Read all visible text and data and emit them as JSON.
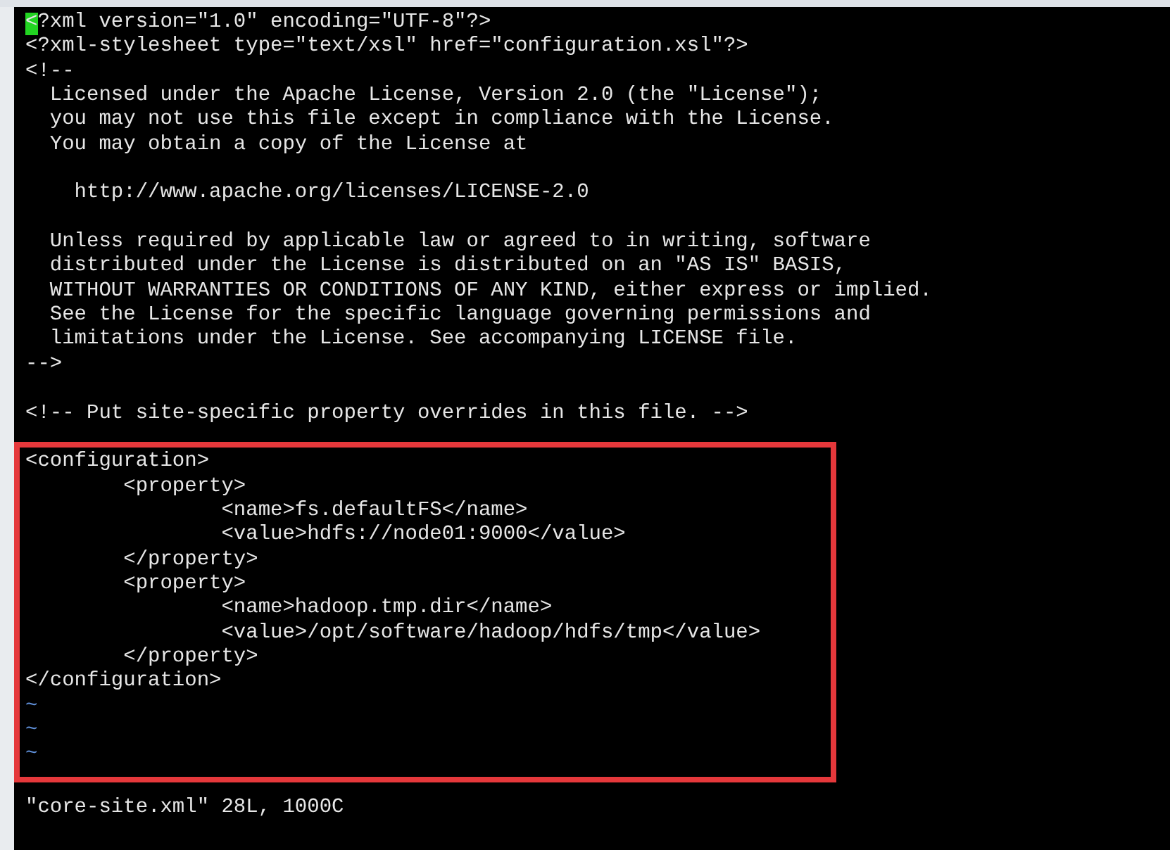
{
  "editor": {
    "lines": [
      {
        "kind": "text",
        "text": "<?xml version=\"1.0\" encoding=\"UTF-8\"?>",
        "cursor": true
      },
      {
        "kind": "text",
        "text": "<?xml-stylesheet type=\"text/xsl\" href=\"configuration.xsl\"?>"
      },
      {
        "kind": "text",
        "text": "<!--"
      },
      {
        "kind": "text",
        "text": "  Licensed under the Apache License, Version 2.0 (the \"License\");"
      },
      {
        "kind": "text",
        "text": "  you may not use this file except in compliance with the License."
      },
      {
        "kind": "text",
        "text": "  You may obtain a copy of the License at"
      },
      {
        "kind": "blank"
      },
      {
        "kind": "text",
        "text": "    http://www.apache.org/licenses/LICENSE-2.0"
      },
      {
        "kind": "blank"
      },
      {
        "kind": "text",
        "text": "  Unless required by applicable law or agreed to in writing, software"
      },
      {
        "kind": "text",
        "text": "  distributed under the License is distributed on an \"AS IS\" BASIS,"
      },
      {
        "kind": "text",
        "text": "  WITHOUT WARRANTIES OR CONDITIONS OF ANY KIND, either express or implied."
      },
      {
        "kind": "text",
        "text": "  See the License for the specific language governing permissions and"
      },
      {
        "kind": "text",
        "text": "  limitations under the License. See accompanying LICENSE file."
      },
      {
        "kind": "text",
        "text": "-->"
      },
      {
        "kind": "blank"
      },
      {
        "kind": "text",
        "text": "<!-- Put site-specific property overrides in this file. -->"
      },
      {
        "kind": "blank"
      }
    ],
    "highlight_frame": {
      "lines": [
        {
          "kind": "text",
          "text": "<configuration>"
        },
        {
          "kind": "text",
          "text": "        <property>"
        },
        {
          "kind": "text",
          "text": "                <name>fs.defaultFS</name>"
        },
        {
          "kind": "text",
          "text": "                <value>hdfs://node01:9000</value>"
        },
        {
          "kind": "text",
          "text": "        </property>"
        },
        {
          "kind": "text",
          "text": "        <property>"
        },
        {
          "kind": "text",
          "text": "                <name>hadoop.tmp.dir</name>"
        },
        {
          "kind": "text",
          "text": "                <value>/opt/software/hadoop/hdfs/tmp</value>"
        },
        {
          "kind": "text",
          "text": "        </property>"
        },
        {
          "kind": "text",
          "text": "</configuration>"
        },
        {
          "kind": "tilde",
          "text": "~"
        },
        {
          "kind": "tilde",
          "text": "~"
        },
        {
          "kind": "tilde",
          "text": "~"
        }
      ]
    }
  },
  "status_line": "\"core-site.xml\" 28L, 1000C"
}
